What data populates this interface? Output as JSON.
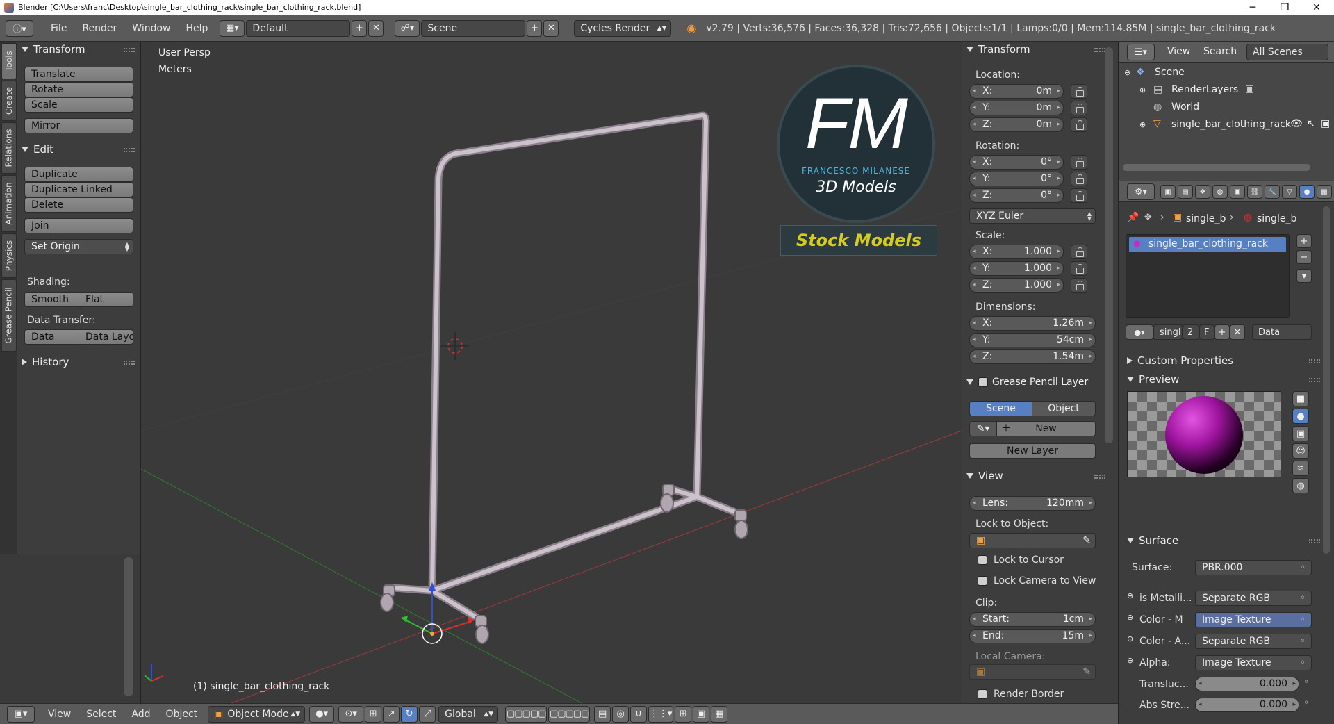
{
  "window": {
    "title": "Blender [C:\\Users\\franc\\Desktop\\single_bar_clothing_rack\\single_bar_clothing_rack.blend]",
    "minimize": "─",
    "maximize": "❐",
    "close": "✕"
  },
  "info_header": {
    "menus": [
      "File",
      "Render",
      "Window",
      "Help"
    ],
    "layout": "Default",
    "scene": "Scene",
    "engine": "Cycles Render",
    "stats": "v2.79 | Verts:36,576 | Faces:36,328 | Tris:72,656 | Objects:1/1 | Lamps:0/0 | Mem:114.85M | single_bar_clothing_rack"
  },
  "tool_tabs": [
    "Tools",
    "Create",
    "Relations",
    "Animation",
    "Physics",
    "Grease Pencil"
  ],
  "toolshelf": {
    "transform_title": "Transform",
    "translate": "Translate",
    "rotate": "Rotate",
    "scale": "Scale",
    "mirror": "Mirror",
    "edit_title": "Edit",
    "duplicate": "Duplicate",
    "duplicate_linked": "Duplicate Linked",
    "delete": "Delete",
    "join": "Join",
    "set_origin": "Set Origin",
    "shading_label": "Shading:",
    "smooth": "Smooth",
    "flat": "Flat",
    "data_transfer_label": "Data Transfer:",
    "data": "Data",
    "data_layout": "Data Layo",
    "history_title": "History"
  },
  "viewport": {
    "view_name": "User Persp",
    "units": "Meters",
    "object_label": "(1) single_bar_clothing_rack",
    "logo_letters": "FM",
    "logo_name": "FRANCESCO MILANESE",
    "logo_sub": "3D Models",
    "stock_label": "Stock Models",
    "colors": {
      "rack": "#c6bcc6",
      "axis_red": "#a33a3a",
      "axis_green": "#2f7a2f"
    }
  },
  "npanel": {
    "transform_title": "Transform",
    "location_label": "Location:",
    "location": {
      "x": "0m",
      "y": "0m",
      "z": "0m"
    },
    "rotation_label": "Rotation:",
    "rotation": {
      "x": "0°",
      "y": "0°",
      "z": "0°"
    },
    "rotation_mode": "XYZ Euler",
    "scale_label": "Scale:",
    "scale": {
      "x": "1.000",
      "y": "1.000",
      "z": "1.000"
    },
    "dimensions_label": "Dimensions:",
    "dimensions": {
      "x": "1.26m",
      "y": "54cm",
      "z": "1.54m"
    },
    "axis": {
      "x": "X:",
      "y": "Y:",
      "z": "Z:"
    },
    "grease_title": "Grease Pencil Layer",
    "scene_btn": "Scene",
    "object_btn": "Object",
    "new_btn": "New",
    "new_layer_btn": "New Layer",
    "view_title": "View",
    "lens_label": "Lens:",
    "lens": "120mm",
    "lock_object_label": "Lock to Object:",
    "lock_cursor": "Lock to Cursor",
    "lock_camera": "Lock Camera to View",
    "clip_label": "Clip:",
    "clip_start_label": "Start:",
    "clip_start": "1cm",
    "clip_end_label": "End:",
    "clip_end": "15m",
    "local_camera_label": "Local Camera:",
    "render_border": "Render Border"
  },
  "outliner": {
    "view_menu": "View",
    "search_menu": "Search",
    "filter": "All Scenes",
    "items": {
      "scene": "Scene",
      "renderlayers": "RenderLayers",
      "world": "World",
      "object": "single_bar_clothing_rack"
    }
  },
  "properties": {
    "breadcrumb_1": "single_b",
    "breadcrumb_2": "single_b",
    "material_slot": "single_bar_clothing_rack",
    "mat_name": "singl",
    "mat_users": "2",
    "mat_fake": "F",
    "mat_link": "Data",
    "custom_props_title": "Custom Properties",
    "preview_title": "Preview",
    "surface_title": "Surface",
    "surface_label": "Surface:",
    "surface_value": "PBR.000",
    "inputs": [
      {
        "label": "is Metalli...",
        "value": "Separate RGB"
      },
      {
        "label": "Color - M",
        "value": "Image Texture"
      },
      {
        "label": "Color - A...",
        "value": "Separate RGB"
      },
      {
        "label": "Alpha:",
        "value": "Image Texture"
      }
    ],
    "transluc_label": "Transluc...",
    "transluc_value": "0.000",
    "abs_label": "Abs Stre...",
    "abs_value": "0.000"
  },
  "bottom_header": {
    "menus": [
      "View",
      "Select",
      "Add",
      "Object"
    ],
    "mode": "Object Mode",
    "orientation": "Global"
  }
}
